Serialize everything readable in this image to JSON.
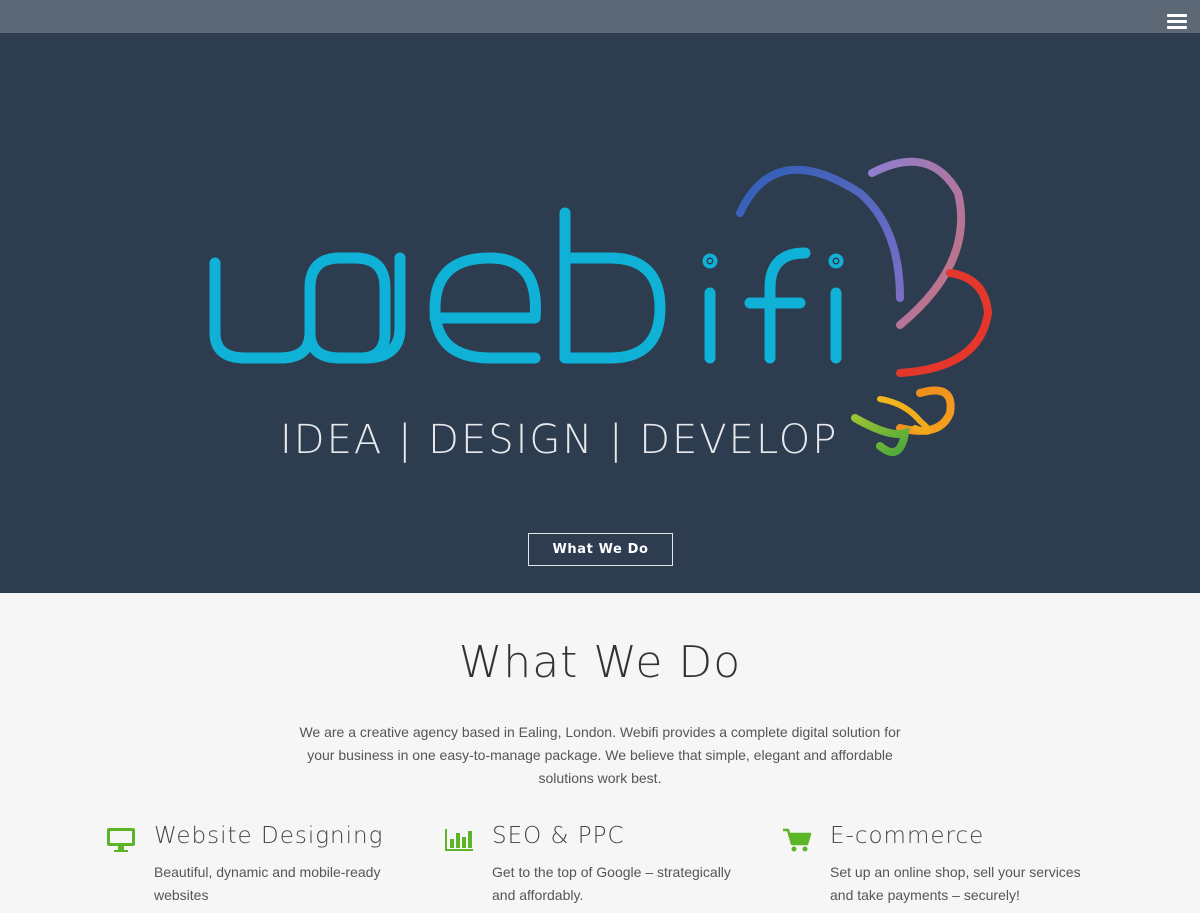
{
  "header": {
    "menu_icon": "hamburger-menu-icon"
  },
  "hero": {
    "brand": "webifi",
    "tagline": "IDEA | DESIGN | DEVELOP",
    "button_label": "What We Do"
  },
  "what_we_do": {
    "title": "What We Do",
    "intro": "We are a creative agency based in Ealing, London. Webifi provides a complete digital solution for your business in one easy-to-manage package. We believe that simple, elegant and affordable solutions work best.",
    "services": [
      {
        "icon": "monitor-icon",
        "title": "Website Designing",
        "text": "Beautiful, dynamic and mobile-ready websites"
      },
      {
        "icon": "bar-chart-icon",
        "title": "SEO & PPC",
        "text": "Get to the top of Google – strategically and affordably."
      },
      {
        "icon": "shopping-cart-icon",
        "title": "E-commerce",
        "text": "Set up an online shop, sell your services and take payments – securely!"
      }
    ]
  },
  "colors": {
    "header_bg": "#5c6876",
    "hero_bg": "#2e3c50",
    "brand_cyan": "#0fb2d6",
    "accent_green": "#5cb526",
    "section_bg": "#f6f6f6"
  }
}
